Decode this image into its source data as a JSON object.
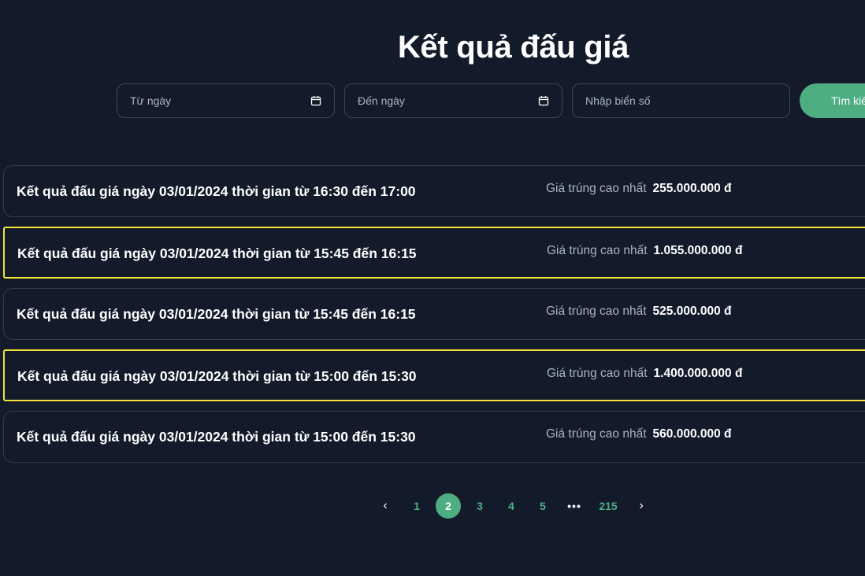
{
  "page": {
    "title": "Kết quả đấu giá"
  },
  "filters": {
    "from_date_placeholder": "Từ ngày",
    "to_date_placeholder": "Đến ngày",
    "plate_placeholder": "Nhập biển số",
    "search_label": "Tìm kiếm"
  },
  "results": [
    {
      "title": "Kết quả đấu giá ngày 03/01/2024 thời gian từ 16:30 đến 17:00",
      "price_label": "Giá trúng cao nhất",
      "price_value": "255.000.000 đ",
      "highlighted": false
    },
    {
      "title": "Kết quả đấu giá ngày 03/01/2024 thời gian từ 15:45 đến 16:15",
      "price_label": "Giá trúng cao nhất",
      "price_value": "1.055.000.000 đ",
      "highlighted": true
    },
    {
      "title": "Kết quả đấu giá ngày 03/01/2024 thời gian từ 15:45 đến 16:15",
      "price_label": "Giá trúng cao nhất",
      "price_value": "525.000.000 đ",
      "highlighted": false
    },
    {
      "title": "Kết quả đấu giá ngày 03/01/2024 thời gian từ 15:00 đến 15:30",
      "price_label": "Giá trúng cao nhất",
      "price_value": "1.400.000.000 đ",
      "highlighted": true
    },
    {
      "title": "Kết quả đấu giá ngày 03/01/2024 thời gian từ 15:00 đến 15:30",
      "price_label": "Giá trúng cao nhất",
      "price_value": "560.000.000 đ",
      "highlighted": false
    }
  ],
  "pagination": {
    "prev": "‹",
    "next": "›",
    "pages": [
      "1",
      "2",
      "3",
      "4",
      "5"
    ],
    "ellipsis": "•••",
    "last": "215",
    "current": "2"
  },
  "colors": {
    "background": "#131b2b",
    "accent": "#4eae82",
    "highlight_border": "#f4e33a"
  }
}
